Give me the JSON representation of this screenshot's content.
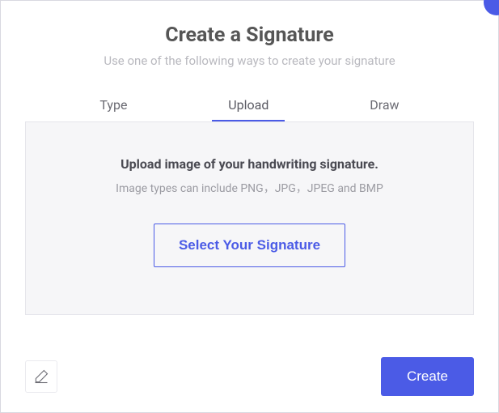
{
  "header": {
    "title": "Create a Signature",
    "subtitle": "Use one of the following ways to create your signature"
  },
  "tabs": {
    "type": "Type",
    "upload": "Upload",
    "draw": "Draw"
  },
  "panel": {
    "heading": "Upload image of your handwriting signature.",
    "subtext": "Image types can include PNG，JPG，JPEG and BMP",
    "select_button": "Select Your Signature"
  },
  "footer": {
    "create_button": "Create"
  }
}
